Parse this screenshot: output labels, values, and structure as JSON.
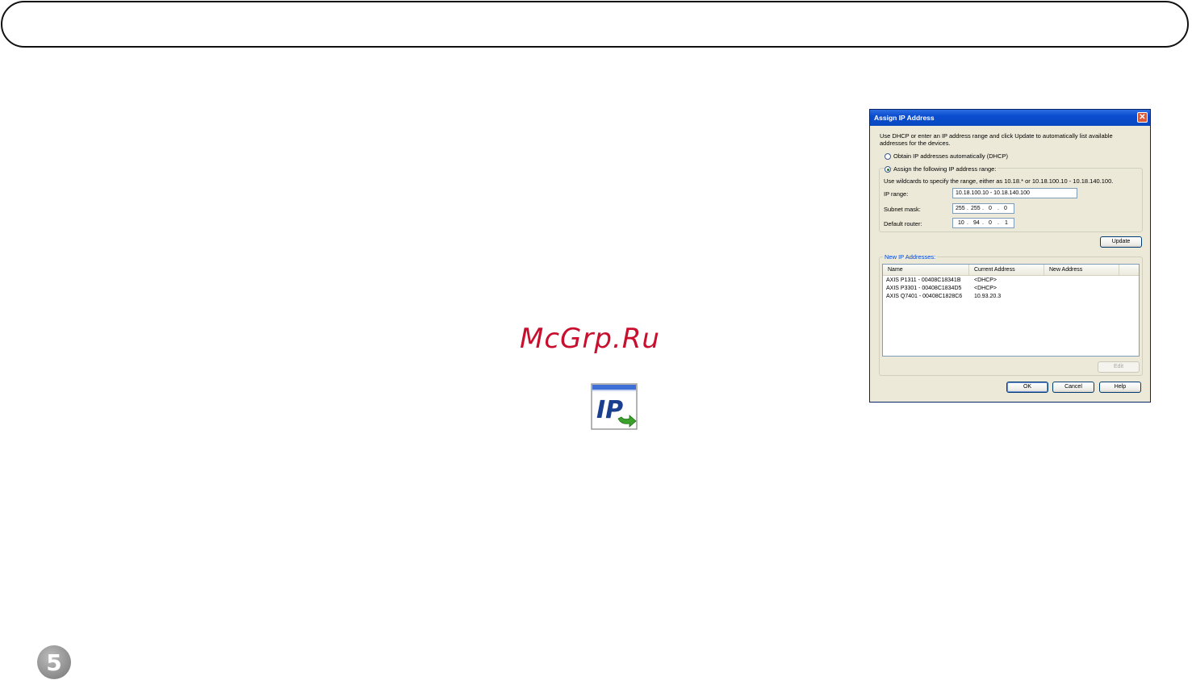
{
  "watermark": "McGrp.Ru",
  "page_number": "5",
  "icons": {
    "ip_icon": "ip-address-icon",
    "close_icon": "close-icon"
  },
  "dialog": {
    "title": "Assign IP Address",
    "intro_line1": "Use DHCP or enter an IP address range and click Update to automatically list available",
    "intro_line2": "addresses for the devices.",
    "radio_dhcp": "Obtain IP addresses automatically (DHCP)",
    "radio_assign": "Assign the following IP address range:",
    "wildcards_hint": "Use wildcards to specify the range, either as 10.18.* or 10.18.100.10 - 10.18.140.100.",
    "ip_range_label": "IP range:",
    "ip_range_value": "10.18.100.10 - 10.18.140.100",
    "subnet_label": "Subnet mask:",
    "subnet_octets": [
      "255",
      "255",
      "0",
      "0"
    ],
    "router_label": "Default router:",
    "router_octets": [
      "10",
      "94",
      "0",
      "1"
    ],
    "update_button": "Update",
    "new_ip_group": "New IP Addresses:",
    "columns": [
      "Name",
      "Current Address",
      "New Address"
    ],
    "rows": [
      {
        "name": "AXIS P1311 - 00408C18341B",
        "current": "<DHCP>",
        "new": ""
      },
      {
        "name": "AXIS P3301 - 00408C1834D5",
        "current": "<DHCP>",
        "new": ""
      },
      {
        "name": "AXIS Q7401 - 00408C1828C6",
        "current": "10.93.20.3",
        "new": ""
      }
    ],
    "edit_button": "Edit",
    "ok_button": "OK",
    "cancel_button": "Cancel",
    "help_button": "Help"
  }
}
